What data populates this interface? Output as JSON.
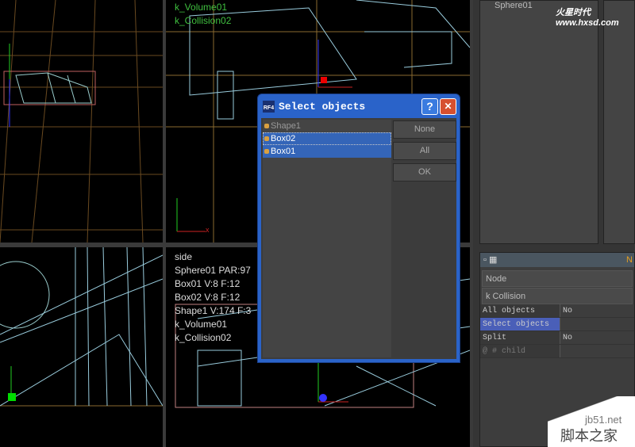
{
  "viewports": {
    "top_right_labels": [
      "k_Volume01",
      "k_Collision02"
    ],
    "bottom_right_labels": [
      "side",
      "Sphere01 PAR:97",
      "Box01 V:8 F:12",
      "Box02 V:8 F:12",
      "Shape1 V:174 F:3",
      "k_Volume01",
      "k_Collision02"
    ],
    "axis_label": "x",
    "label_color": "#3fbf3f"
  },
  "outliner": {
    "item": "Sphere01"
  },
  "properties": {
    "header_right": "N",
    "node_label": "Node",
    "type_label": "k Collision",
    "attributes": [
      {
        "name": "All objects",
        "value": "No"
      },
      {
        "name": "Select objects",
        "value": ""
      },
      {
        "name": "Split",
        "value": "No"
      },
      {
        "name": "@ # child",
        "value": ""
      }
    ]
  },
  "dialog": {
    "title": "Select objects",
    "logo": "RF4",
    "help": "?",
    "close": "✕",
    "items": [
      {
        "label": "Shape1",
        "selected": false
      },
      {
        "label": "Box02",
        "selected": true
      },
      {
        "label": "Box01",
        "selected": true
      }
    ],
    "buttons": {
      "none": "None",
      "all": "All",
      "ok": "OK"
    }
  },
  "watermarks": {
    "top": "火星时代 www.hxsd.com",
    "bottom_site": "jb51.net",
    "bottom_name": "脚本之家"
  }
}
